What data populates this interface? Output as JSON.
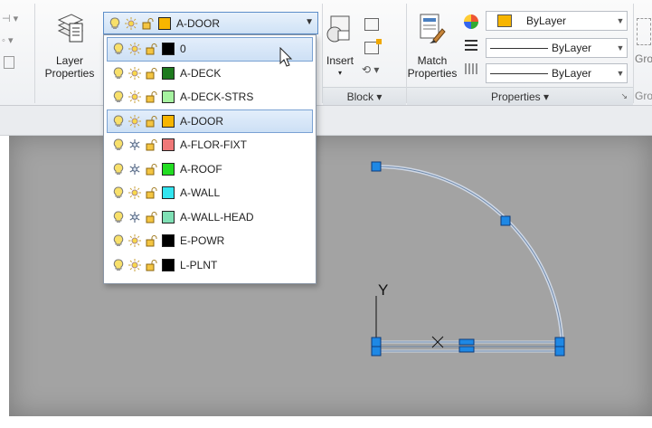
{
  "ribbon": {
    "layer_properties_label_1": "Layer",
    "layer_properties_label_2": "Properties",
    "insert_label": "Insert",
    "match_properties_label_1": "Match",
    "match_properties_label_2": "Properties",
    "block_panel_title": "Block ▾",
    "properties_panel_title": "Properties ▾",
    "gro_label": "Gro",
    "gro_label_2": "Gro"
  },
  "properties_panel": {
    "color": {
      "value": "ByLayer",
      "swatch": "#f7b500"
    },
    "linetype": {
      "value": "ByLayer"
    },
    "lineweight": {
      "value": "ByLayer"
    }
  },
  "layer_combo": {
    "current": "A-DOOR",
    "current_color": "#f7b500"
  },
  "layers": [
    {
      "name": "0",
      "color": "#000000",
      "frozen": false,
      "highlighted": true
    },
    {
      "name": "A-DECK",
      "color": "#1e7a1e",
      "frozen": false,
      "highlighted": false
    },
    {
      "name": "A-DECK-STRS",
      "color": "#a6f2a0",
      "frozen": false,
      "highlighted": false
    },
    {
      "name": "A-DOOR",
      "color": "#f7b500",
      "frozen": false,
      "highlighted": true
    },
    {
      "name": "A-FLOR-FIXT",
      "color": "#f07878",
      "frozen": true,
      "highlighted": false
    },
    {
      "name": "A-ROOF",
      "color": "#22dd22",
      "frozen": true,
      "highlighted": false
    },
    {
      "name": "A-WALL",
      "color": "#33e5f0",
      "frozen": false,
      "highlighted": false
    },
    {
      "name": "A-WALL-HEAD",
      "color": "#7fe0b5",
      "frozen": true,
      "highlighted": false
    },
    {
      "name": "E-POWR",
      "color": "#000000",
      "frozen": false,
      "highlighted": false
    },
    {
      "name": "L-PLNT",
      "color": "#000000",
      "frozen": false,
      "highlighted": false
    }
  ],
  "drawing": {
    "ucs_y_label": "Y"
  },
  "colors": {
    "selection_blue": "#1e88e5",
    "door_line": "#c9d6e6"
  }
}
